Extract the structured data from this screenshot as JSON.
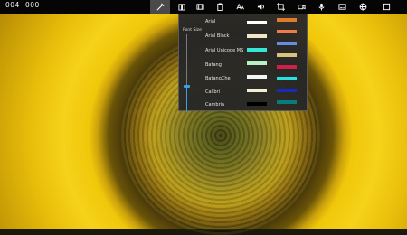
{
  "topbar": {
    "time_elapsed": "004",
    "time_total": "000",
    "tools": [
      {
        "icon": "pen-icon",
        "active": true
      },
      {
        "icon": "book-icon",
        "active": false
      },
      {
        "icon": "film-strip-icon",
        "active": false
      },
      {
        "icon": "clipboard-icon",
        "active": false
      },
      {
        "icon": "text-case-icon",
        "active": false
      },
      {
        "icon": "speaker-icon",
        "active": false
      },
      {
        "icon": "video-camera-icon",
        "active": false
      },
      {
        "icon": "microphone-icon",
        "active": false
      },
      {
        "icon": "subtitles-icon",
        "active": false
      },
      {
        "icon": "globe-icon",
        "active": false
      },
      {
        "icon": "fullscreen-icon",
        "active": false
      }
    ]
  },
  "popup": {
    "size_label": "Font Size",
    "font_size_level_percent": 32,
    "fonts": [
      {
        "name": "Arial"
      },
      {
        "name": "Arial Black"
      },
      {
        "name": "Arial Unicode MS"
      },
      {
        "name": "Batang"
      },
      {
        "name": "BatangChe"
      },
      {
        "name": "Calibri"
      },
      {
        "name": "Cambria"
      }
    ],
    "swatches_col1": [
      "#ffffff",
      "#f3e6c8",
      "#37e6d6",
      "#b8f0c4",
      "#f5f5f5",
      "#f5edd6",
      "#000000"
    ],
    "swatches_col2": [
      "#e07a2c",
      "#f07a4a",
      "#6a8ce0",
      "#d9c37a",
      "#d0204a",
      "#28e0e0",
      "#1a2ab8",
      "#0a7a7a"
    ]
  }
}
